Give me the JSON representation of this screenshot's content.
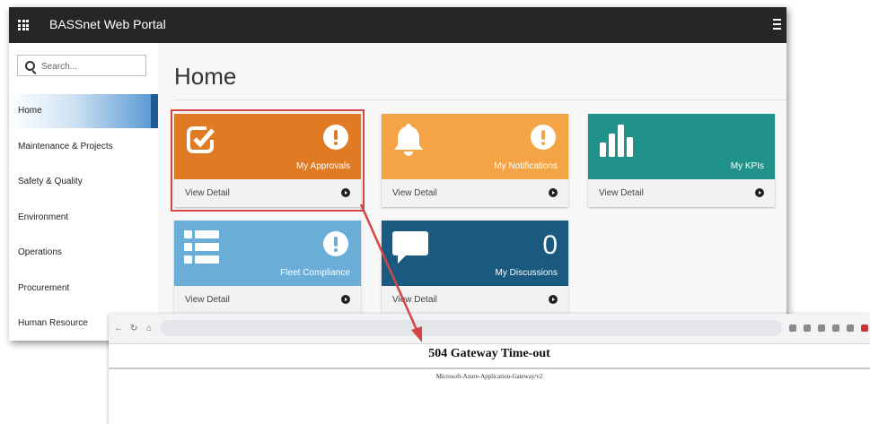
{
  "header": {
    "app_title": "BASSnet Web Portal"
  },
  "search": {
    "placeholder": "Search..."
  },
  "sidebar": {
    "items": [
      {
        "label": "Home",
        "active": true
      },
      {
        "label": "Maintenance & Projects",
        "active": false
      },
      {
        "label": "Safety & Quality",
        "active": false
      },
      {
        "label": "Environment",
        "active": false
      },
      {
        "label": "Operations",
        "active": false
      },
      {
        "label": "Procurement",
        "active": false
      },
      {
        "label": "Human Resource",
        "active": false
      }
    ]
  },
  "main": {
    "page_title": "Home",
    "view_detail_label": "View Detail",
    "tiles": [
      {
        "label": "My Approvals",
        "color": "#e07b24",
        "icon": "check-square-icon",
        "badge": "alert-icon",
        "highlighted": true
      },
      {
        "label": "My Notifications",
        "color": "#f5a445",
        "icon": "bell-icon",
        "badge": "alert-icon",
        "highlighted": false
      },
      {
        "label": "My KPIs",
        "color": "#21928a",
        "icon": "bar-chart-icon",
        "highlighted": false
      },
      {
        "label": "Fleet Compliance",
        "color": "#6aaed8",
        "icon": "list-icon",
        "badge": "alert-icon",
        "highlighted": false
      },
      {
        "label": "My Discussions",
        "count": "0",
        "color": "#1a5a80",
        "icon": "chat-bubble-icon",
        "highlighted": false
      }
    ]
  },
  "error_page": {
    "title": "504 Gateway Time-out",
    "subtitle": "Microsoft-Azure-Application-Gateway/v2"
  },
  "colors": {
    "topbar": "#262626",
    "highlight": "#d64545",
    "sidebar_active_bar": "#1f5a96"
  }
}
